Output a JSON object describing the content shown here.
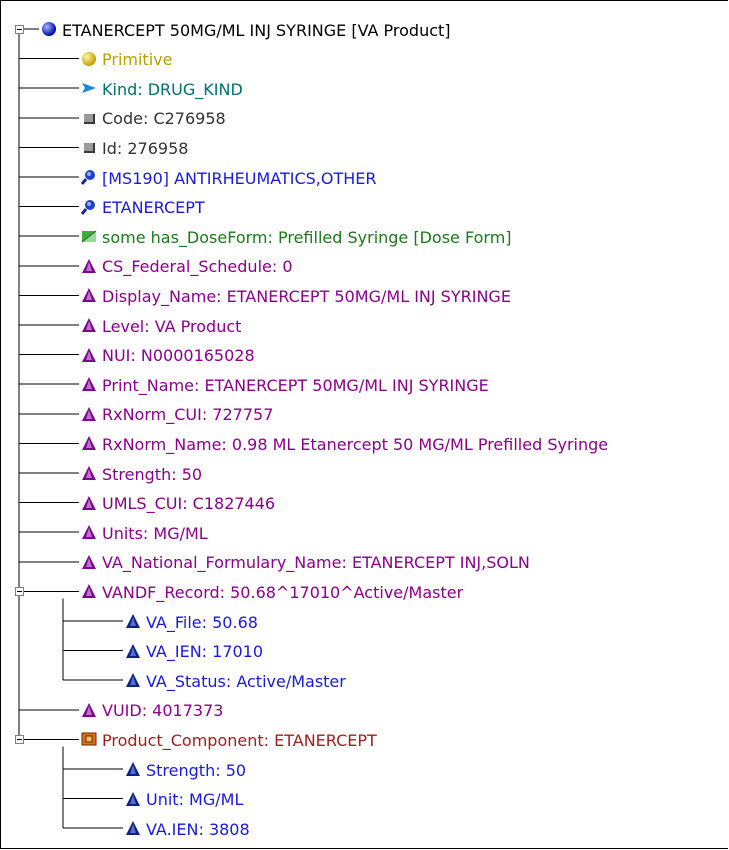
{
  "tree": {
    "root": {
      "label": "ETANERCEPT 50MG/ML INJ SYRINGE [VA Product]",
      "icon": "blue-sphere-icon",
      "color": "#000000"
    },
    "primitive": {
      "label": "Primitive",
      "icon": "yellow-sphere-icon",
      "color": "#b8a000"
    },
    "kind": {
      "label": "Kind:  DRUG_KIND",
      "icon": "kind-arrow-icon",
      "color": "#007070"
    },
    "code": {
      "label": "Code:  C276958",
      "icon": "gray-block-icon",
      "color": "#333333"
    },
    "id": {
      "label": "Id:  276958",
      "icon": "gray-block-icon",
      "color": "#333333"
    },
    "ms190": {
      "label": "[MS190] ANTIRHEUMATICS,OTHER",
      "icon": "magnifier-icon",
      "color": "#1a1adc"
    },
    "etanercept_ref": {
      "label": "ETANERCEPT",
      "icon": "magnifier-icon",
      "color": "#1a1adc"
    },
    "doseform": {
      "label": "some has_DoseForm: Prefilled Syringe [Dose Form]",
      "icon": "green-restriction-icon",
      "color": "#1a7a1a"
    },
    "properties": [
      {
        "label": "CS_Federal_Schedule: 0",
        "icon": "purple-triangle-icon"
      },
      {
        "label": "Display_Name: ETANERCEPT 50MG/ML INJ SYRINGE",
        "icon": "purple-triangle-icon"
      },
      {
        "label": "Level: VA Product",
        "icon": "purple-triangle-icon"
      },
      {
        "label": "NUI: N0000165028",
        "icon": "purple-triangle-icon"
      },
      {
        "label": "Print_Name: ETANERCEPT 50MG/ML INJ SYRINGE",
        "icon": "purple-triangle-icon"
      },
      {
        "label": "RxNorm_CUI: 727757",
        "icon": "purple-triangle-icon"
      },
      {
        "label": "RxNorm_Name: 0.98 ML Etanercept 50 MG/ML Prefilled Syringe",
        "icon": "purple-triangle-icon"
      },
      {
        "label": "Strength: 50",
        "icon": "purple-triangle-icon"
      },
      {
        "label": "UMLS_CUI: C1827446",
        "icon": "purple-triangle-icon"
      },
      {
        "label": "Units: MG/ML",
        "icon": "purple-triangle-icon"
      },
      {
        "label": "VA_National_Formulary_Name: ETANERCEPT INJ,SOLN",
        "icon": "purple-triangle-icon"
      }
    ],
    "vandf": {
      "label": "VANDF_Record: 50.68^17010^Active/Master",
      "icon": "purple-triangle-icon"
    },
    "vandf_children": [
      {
        "label": "VA_File: 50.68",
        "icon": "navy-triangle-icon"
      },
      {
        "label": "VA_IEN: 17010",
        "icon": "navy-triangle-icon"
      },
      {
        "label": "VA_Status: Active/Master",
        "icon": "navy-triangle-icon"
      }
    ],
    "vuid": {
      "label": "VUID: 4017373",
      "icon": "purple-triangle-icon"
    },
    "product_component": {
      "label": "Product_Component: ETANERCEPT",
      "icon": "orange-box-icon",
      "color": "#a02020"
    },
    "pc_children": [
      {
        "label": "Strength: 50",
        "icon": "navy-triangle-icon"
      },
      {
        "label": "Unit: MG/ML",
        "icon": "navy-triangle-icon"
      },
      {
        "label": "VA.IEN: 3808",
        "icon": "navy-triangle-icon"
      }
    ],
    "colors": {
      "property": "#8b008b",
      "nested_property": "#1a1adc",
      "connector": "#000000"
    }
  }
}
